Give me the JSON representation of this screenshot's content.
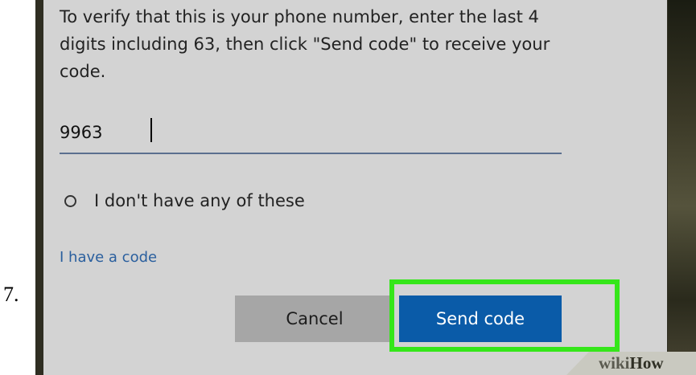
{
  "step": {
    "number": "7."
  },
  "dialog": {
    "instruction": "To verify that this is your phone number, enter the last 4 digits including 63, then click \"Send code\" to receive your code.",
    "input": {
      "value": "9963",
      "placeholder": ""
    },
    "radio": {
      "label": "I don't have any of these",
      "checked": false
    },
    "link": {
      "label": "I have a code"
    },
    "buttons": {
      "cancel": "Cancel",
      "send": "Send code"
    }
  },
  "colors": {
    "primary": "#0a5ba8",
    "highlight": "#35e61a",
    "link": "#2a5f9e",
    "dialog_bg": "#d3d3d3"
  },
  "watermark": {
    "wiki": "wiki",
    "how": "How"
  }
}
